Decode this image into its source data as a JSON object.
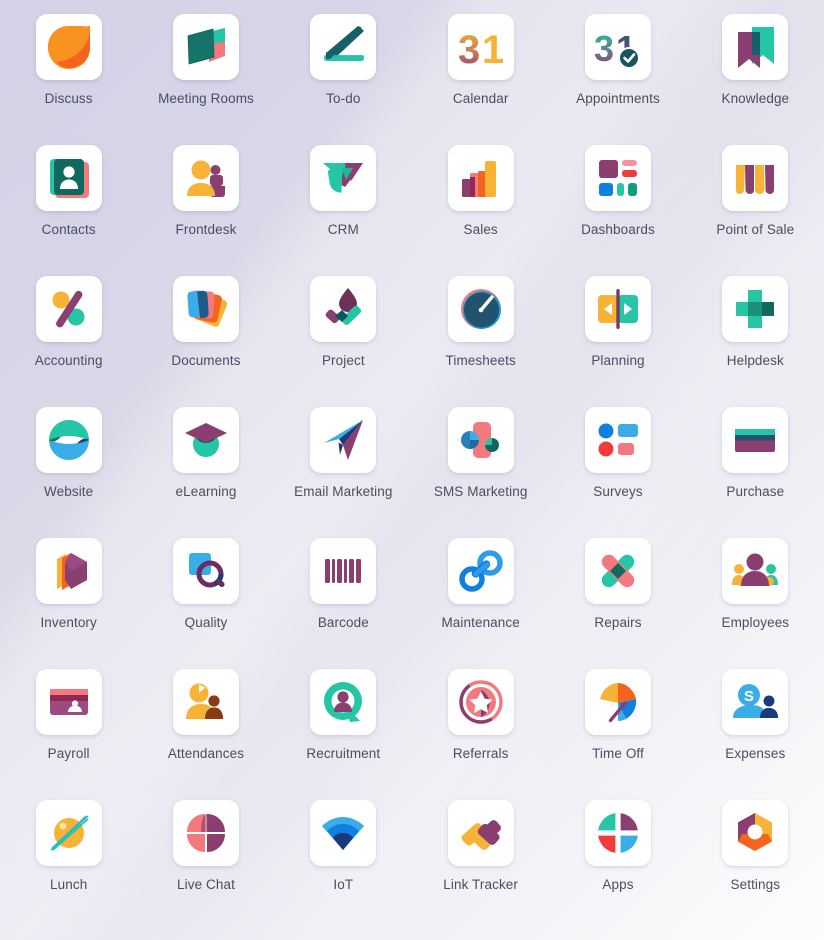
{
  "page": {
    "title": "Odoo Apps Launcher",
    "background_top_color": "#d5d3e6",
    "background_bottom_color": "#fdfdfe",
    "tile_background": "#ffffff",
    "label_color": "#4a4d62",
    "columns": 6,
    "rows": 7
  },
  "apps": [
    {
      "label": "Discuss",
      "icon": "discuss-icon"
    },
    {
      "label": "Meeting Rooms",
      "icon": "meeting-rooms-icon"
    },
    {
      "label": "To-do",
      "icon": "todo-icon"
    },
    {
      "label": "Calendar",
      "icon": "calendar-icon"
    },
    {
      "label": "Appointments",
      "icon": "appointments-icon"
    },
    {
      "label": "Knowledge",
      "icon": "knowledge-icon"
    },
    {
      "label": "Contacts",
      "icon": "contacts-icon"
    },
    {
      "label": "Frontdesk",
      "icon": "frontdesk-icon"
    },
    {
      "label": "CRM",
      "icon": "crm-icon"
    },
    {
      "label": "Sales",
      "icon": "sales-icon"
    },
    {
      "label": "Dashboards",
      "icon": "dashboards-icon"
    },
    {
      "label": "Point of Sale",
      "icon": "point-of-sale-icon"
    },
    {
      "label": "Accounting",
      "icon": "accounting-icon"
    },
    {
      "label": "Documents",
      "icon": "documents-icon"
    },
    {
      "label": "Project",
      "icon": "project-icon"
    },
    {
      "label": "Timesheets",
      "icon": "timesheets-icon"
    },
    {
      "label": "Planning",
      "icon": "planning-icon"
    },
    {
      "label": "Helpdesk",
      "icon": "helpdesk-icon"
    },
    {
      "label": "Website",
      "icon": "website-icon"
    },
    {
      "label": "eLearning",
      "icon": "elearning-icon"
    },
    {
      "label": "Email Marketing",
      "icon": "email-marketing-icon"
    },
    {
      "label": "SMS Marketing",
      "icon": "sms-marketing-icon"
    },
    {
      "label": "Surveys",
      "icon": "surveys-icon"
    },
    {
      "label": "Purchase",
      "icon": "purchase-icon"
    },
    {
      "label": "Inventory",
      "icon": "inventory-icon"
    },
    {
      "label": "Quality",
      "icon": "quality-icon"
    },
    {
      "label": "Barcode",
      "icon": "barcode-icon"
    },
    {
      "label": "Maintenance",
      "icon": "maintenance-icon"
    },
    {
      "label": "Repairs",
      "icon": "repairs-icon"
    },
    {
      "label": "Employees",
      "icon": "employees-icon"
    },
    {
      "label": "Payroll",
      "icon": "payroll-icon"
    },
    {
      "label": "Attendances",
      "icon": "attendances-icon"
    },
    {
      "label": "Recruitment",
      "icon": "recruitment-icon"
    },
    {
      "label": "Referrals",
      "icon": "referrals-icon"
    },
    {
      "label": "Time Off",
      "icon": "time-off-icon"
    },
    {
      "label": "Expenses",
      "icon": "expenses-icon"
    },
    {
      "label": "Lunch",
      "icon": "lunch-icon"
    },
    {
      "label": "Live Chat",
      "icon": "live-chat-icon"
    },
    {
      "label": "IoT",
      "icon": "iot-icon"
    },
    {
      "label": "Link Tracker",
      "icon": "link-tracker-icon"
    },
    {
      "label": "Apps",
      "icon": "apps-icon"
    },
    {
      "label": "Settings",
      "icon": "settings-icon"
    }
  ],
  "palette": {
    "orange": "#f58220",
    "orange_deep": "#f4641e",
    "teal": "#24c6a5",
    "teal_dark": "#17606b",
    "green_dark": "#11695e",
    "pink": "#f4797f",
    "pink_light": "#f9919a",
    "purple": "#8b3f70",
    "purple_mid": "#9b4b80",
    "yellow": "#f6b335",
    "blue": "#0f7fe0",
    "blue_light": "#3aade8",
    "navy": "#1b3a7a",
    "red": "#ef3b3b",
    "slate": "#21526e"
  }
}
